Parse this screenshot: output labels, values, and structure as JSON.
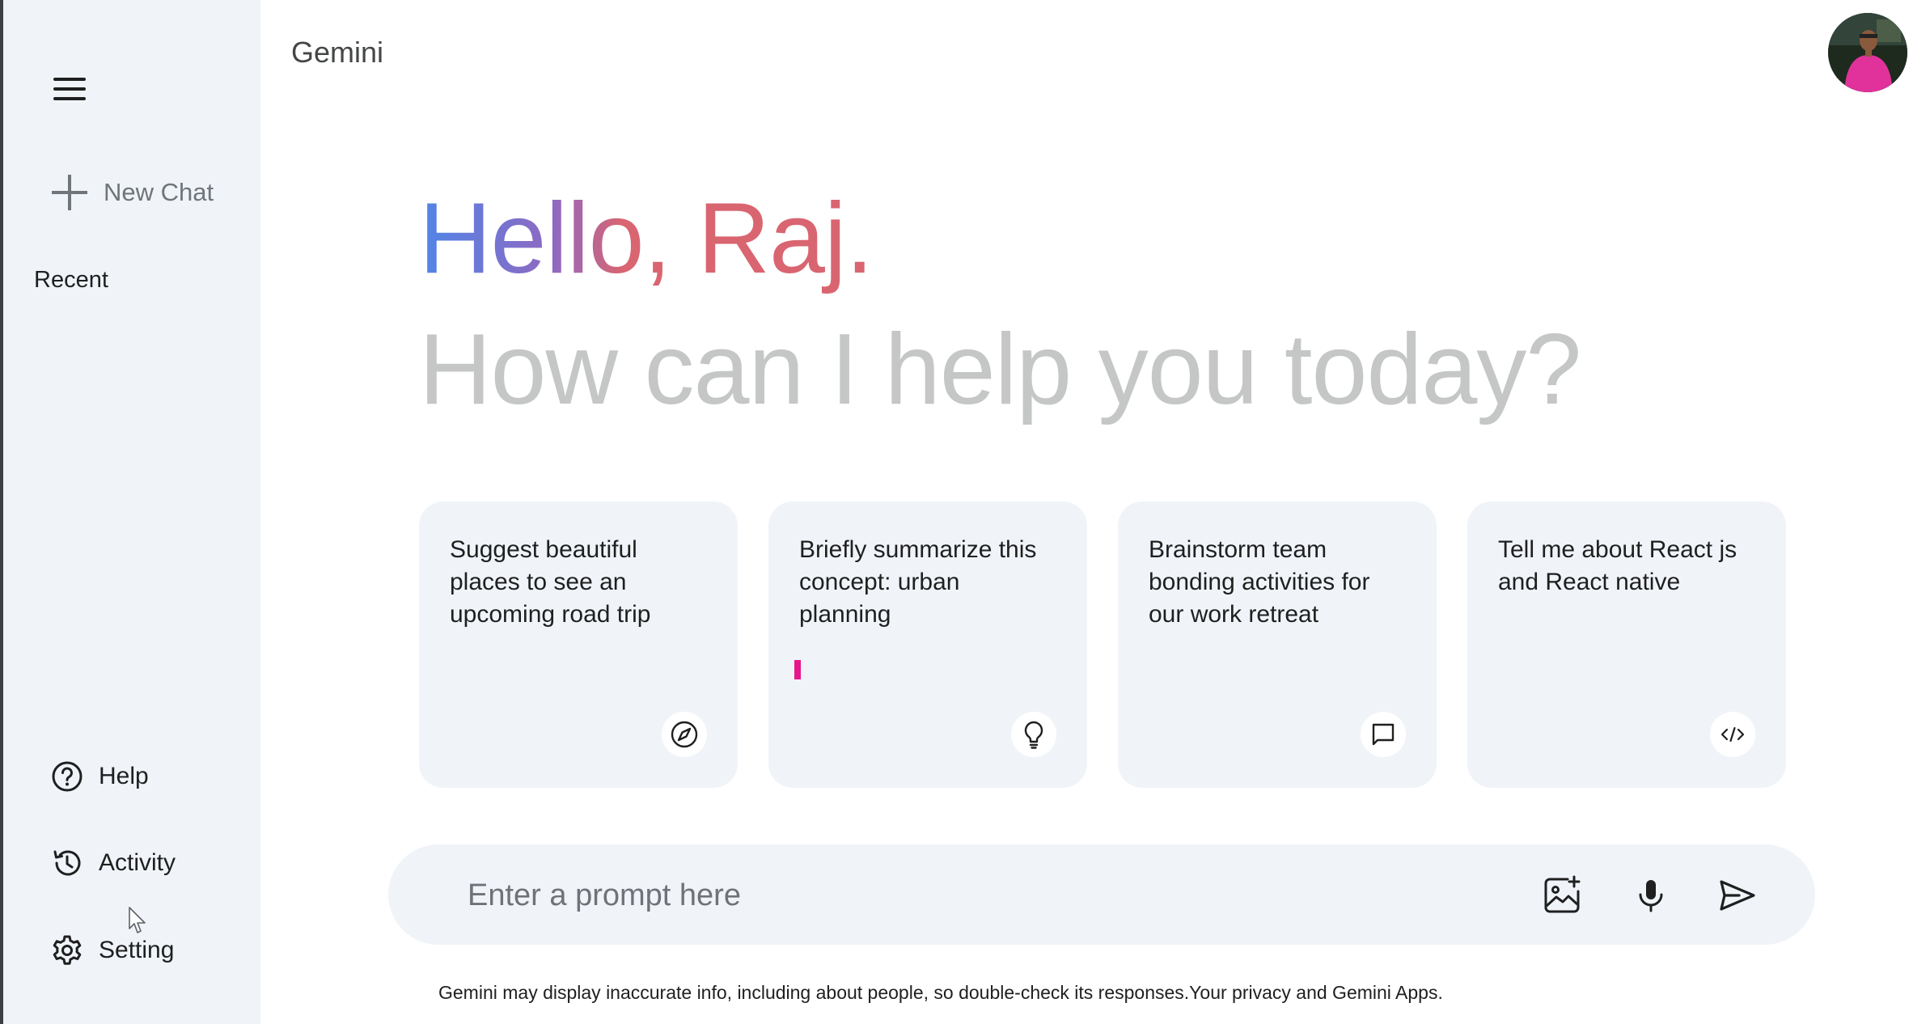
{
  "app": {
    "brand": "Gemini"
  },
  "sidebar": {
    "new_chat_label": "New Chat",
    "recent_title": "Recent",
    "bottom_items": [
      {
        "label": "Help",
        "icon": "help-icon"
      },
      {
        "label": "Activity",
        "icon": "history-icon"
      },
      {
        "label": "Setting",
        "icon": "gear-icon"
      }
    ]
  },
  "greeting": {
    "hello": "Hello, Raj.",
    "subtitle": "How can I help you today?",
    "gradient_colors": [
      "#4f86e8",
      "#9168c0",
      "#d96570"
    ]
  },
  "cards": [
    {
      "text": "Suggest beautiful places to see an upcoming road trip",
      "icon": "compass-icon"
    },
    {
      "text": "Briefly summarize this concept: urban planning",
      "icon": "lightbulb-icon"
    },
    {
      "text": "Brainstorm team bonding activities for our work retreat",
      "icon": "message-icon"
    },
    {
      "text": "Tell me about React js and React native",
      "icon": "code-icon"
    }
  ],
  "prompt": {
    "placeholder": "Enter a prompt here",
    "value": ""
  },
  "footer": {
    "disclaimer": "Gemini may display inaccurate info, including about people, so double-check its responses.Your privacy and Gemini Apps."
  },
  "colors": {
    "sidebar_bg": "#f0f4f9",
    "card_bg": "#f0f4f9",
    "subtitle": "#c4c7c5",
    "caret_accent": "#e8168c"
  }
}
